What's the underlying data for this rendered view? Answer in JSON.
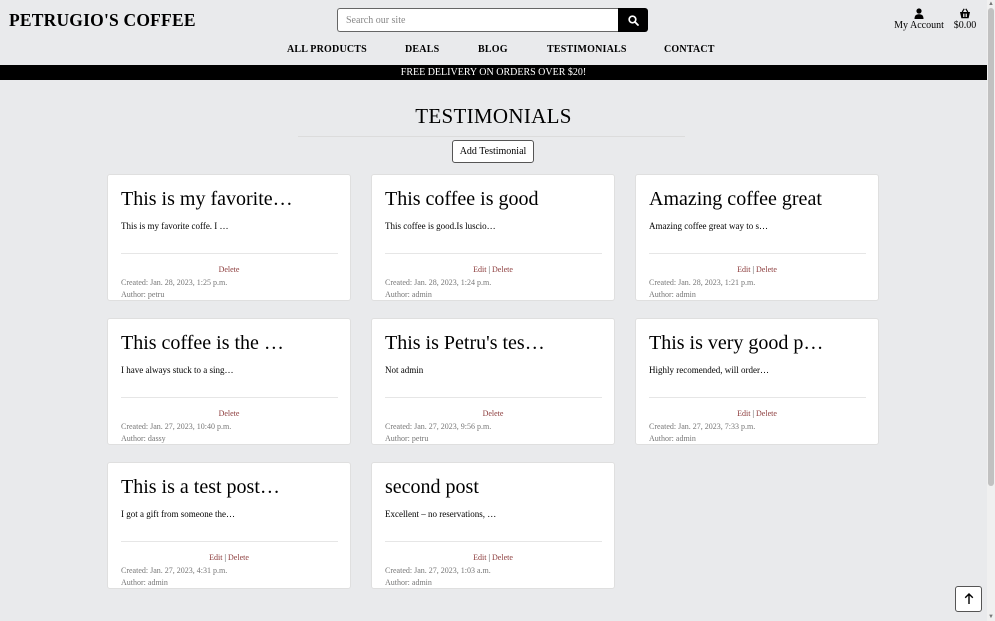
{
  "header": {
    "brand": "PETRUGIO'S COFFEE",
    "search_placeholder": "Search our site",
    "account_label": "My Account",
    "bag_total": "$0.00"
  },
  "nav": {
    "items": [
      {
        "label": "ALL PRODUCTS"
      },
      {
        "label": "DEALS"
      },
      {
        "label": "BLOG"
      },
      {
        "label": "TESTIMONIALS"
      },
      {
        "label": "CONTACT"
      }
    ]
  },
  "banner": "FREE DELIVERY ON ORDERS OVER $20!",
  "page": {
    "title": "TESTIMONIALS",
    "add_button": "Add Testimonial"
  },
  "labels": {
    "edit": "Edit",
    "delete": "Delete",
    "sep": " | "
  },
  "testimonials": [
    {
      "title": "This is my favorite…",
      "excerpt": "This is my favorite coffe. I …",
      "created": "Created: Jan. 28, 2023, 1:25 p.m.",
      "author": "Author: petru",
      "can_edit": false
    },
    {
      "title": "This coffee is good",
      "excerpt": "This coffee is good.Is luscio…",
      "created": "Created: Jan. 28, 2023, 1:24 p.m.",
      "author": "Author: admin",
      "can_edit": true
    },
    {
      "title": "Amazing coffee great",
      "excerpt": "Amazing coffee great way to s…",
      "created": "Created: Jan. 28, 2023, 1:21 p.m.",
      "author": "Author: admin",
      "can_edit": true
    },
    {
      "title": "This coffee is the …",
      "excerpt": "I have always stuck to a sing…",
      "created": "Created: Jan. 27, 2023, 10:40 p.m.",
      "author": "Author: dassy",
      "can_edit": false
    },
    {
      "title": "This is Petru's tes…",
      "excerpt": "Not admin",
      "created": "Created: Jan. 27, 2023, 9:56 p.m.",
      "author": "Author: petru",
      "can_edit": false
    },
    {
      "title": "This is very good p…",
      "excerpt": "Highly recomended, will order…",
      "created": "Created: Jan. 27, 2023, 7:33 p.m.",
      "author": "Author: admin",
      "can_edit": true
    },
    {
      "title": "This is a test post…",
      "excerpt": "I got a gift from someone the…",
      "created": "Created: Jan. 27, 2023, 4:31 p.m.",
      "author": "Author: admin",
      "can_edit": true
    },
    {
      "title": "second post",
      "excerpt": "Excellent – no reservations, …",
      "created": "Created: Jan. 27, 2023, 1:03 a.m.",
      "author": "Author: admin",
      "can_edit": true
    }
  ],
  "icons": {
    "search": "search-icon",
    "account": "user-icon",
    "bag": "basket-icon",
    "back_to_top": "arrow-up-icon"
  }
}
